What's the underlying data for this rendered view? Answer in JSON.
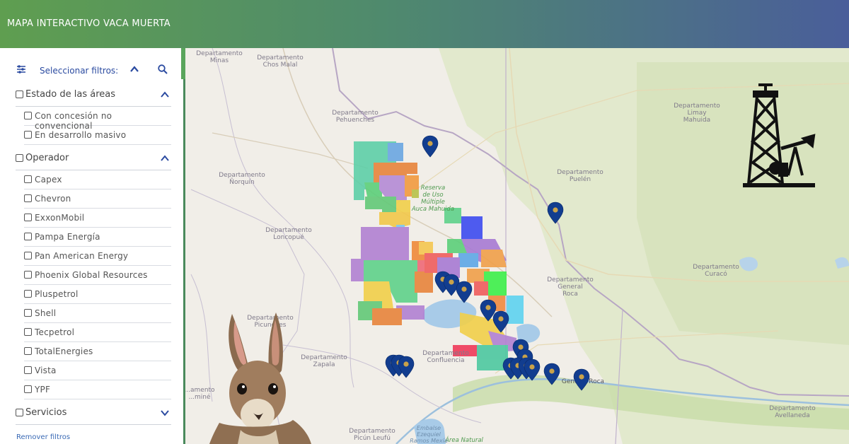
{
  "header": {
    "title": "MAPA INTERACTIVO VACA MUERTA"
  },
  "filters": {
    "title": "Seleccionar filtros:",
    "icons": {
      "filter": "sliders-icon",
      "collapse": "chevron-up-icon",
      "search": "search-icon"
    }
  },
  "sections": {
    "estado": {
      "label": "Estado de las áreas",
      "items": [
        "Con concesión no convencional",
        "En desarrollo masivo"
      ]
    },
    "operador": {
      "label": "Operador",
      "items": [
        "Capex",
        "Chevron",
        "ExxonMobil",
        "Pampa Energía",
        "Pan American Energy",
        "Phoenix Global Resources",
        "Pluspetrol",
        "Shell",
        "Tecpetrol",
        "TotalEnergies",
        "Vista",
        "YPF"
      ]
    },
    "servicios": {
      "label": "Servicios"
    }
  },
  "remove_filters": "Remover filtros",
  "map_labels": {
    "minas": [
      "Departamento",
      "Minas"
    ],
    "chosmalal": [
      "Departamento",
      "Chos Malal"
    ],
    "pehuenches": [
      "Departamento",
      "Pehuenches"
    ],
    "norquin": [
      "Departamento",
      "Ñorquín"
    ],
    "loncopue": [
      "Departamento",
      "Loncopué"
    ],
    "picunches": [
      "Departamento",
      "Picunches"
    ],
    "zapala": [
      "Departamento",
      "Zapala"
    ],
    "confluencia": [
      "Departamento",
      "Confluencia"
    ],
    "picunleufu": [
      "Departamento",
      "Picún Leufú"
    ],
    "limay": [
      "Departamento",
      "Limay",
      "Mahuida"
    ],
    "puelen": [
      "Departamento",
      "Puelén"
    ],
    "generalroca": [
      "Departamento",
      "General",
      "Roca"
    ],
    "curaco": [
      "Departamento",
      "Curacó"
    ],
    "avellaneda": [
      "Departamento",
      "Avellaneda"
    ],
    "aluminé": [
      "...amento",
      "...miné"
    ],
    "reserva": [
      "Reserva",
      "de Uso",
      "Múltiple",
      "Auca Mahuida"
    ],
    "gralroca_city": "General Roca",
    "embalse": [
      "Embalse",
      "Ezequiel",
      "Ramos Mexía"
    ],
    "areanatural": "Área Natural"
  },
  "colors": {
    "marker": "#123d8f",
    "sidebar_accent": "#2a4aa0"
  }
}
